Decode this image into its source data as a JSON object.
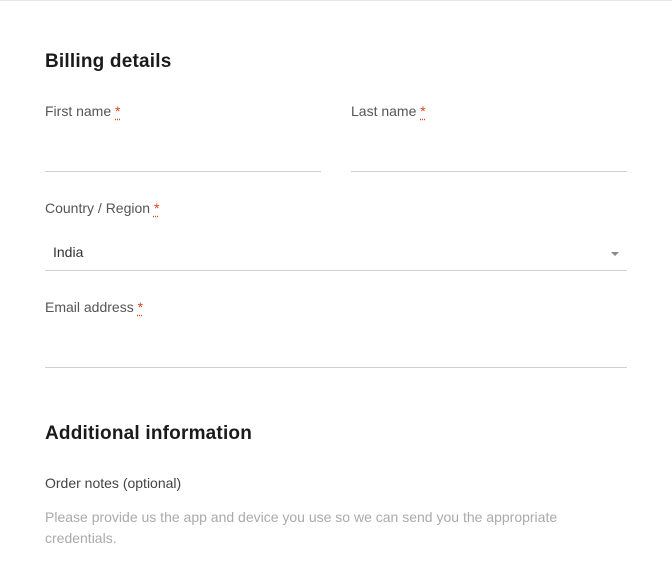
{
  "billing": {
    "heading": "Billing details",
    "first_name": {
      "label": "First name",
      "required": "*",
      "value": ""
    },
    "last_name": {
      "label": "Last name",
      "required": "*",
      "value": ""
    },
    "country": {
      "label": "Country / Region",
      "required": "*",
      "value": "India"
    },
    "email": {
      "label": "Email address",
      "required": "*",
      "value": ""
    }
  },
  "additional": {
    "heading": "Additional information",
    "notes_label": "Order notes (optional)",
    "notes_placeholder": "Please provide us the app and device you use so we can send you the appropriate credentials."
  }
}
